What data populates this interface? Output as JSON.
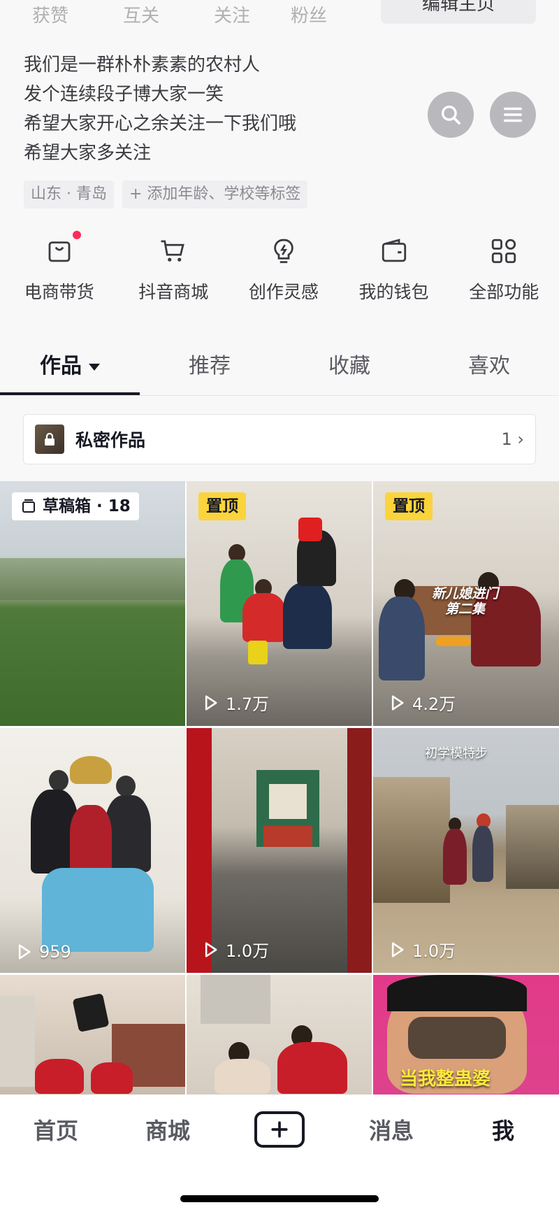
{
  "profile": {
    "stats": [
      "获赞",
      "互关",
      "关注",
      "粉丝"
    ],
    "edit_button": "编辑主页",
    "bio": [
      "我们是一群朴朴素素的农村人",
      "发个连续段子博大家一笑",
      "希望大家开心之余关注一下我们哦",
      "希望大家多关注"
    ],
    "tags": [
      "山东 · 青岛",
      "+ 添加年龄、学校等标签"
    ],
    "search_icon": "search-icon",
    "menu_icon": "menu-icon"
  },
  "functions": [
    {
      "label": "电商带货",
      "icon": "shopping-bag-icon"
    },
    {
      "label": "抖音商城",
      "icon": "cart-icon"
    },
    {
      "label": "创作灵感",
      "icon": "lightbulb-icon"
    },
    {
      "label": "我的钱包",
      "icon": "wallet-icon"
    },
    {
      "label": "全部功能",
      "icon": "grid-icon"
    }
  ],
  "tabs": [
    "作品",
    "推荐",
    "收藏",
    "喜欢"
  ],
  "private_works": {
    "label": "私密作品",
    "count": "1",
    "icon": "lock-icon"
  },
  "videos": [
    {
      "badge": "草稿箱 · 18",
      "plays": ""
    },
    {
      "badge": "置顶",
      "plays": "1.7万"
    },
    {
      "badge": "置顶",
      "plays": "4.2万",
      "caption": "新儿媳进门\n第二集"
    },
    {
      "badge": "",
      "plays": "959"
    },
    {
      "badge": "",
      "plays": "1.0万"
    },
    {
      "badge": "",
      "plays": "1.0万",
      "caption": "初学模特步"
    },
    {
      "badge": "",
      "plays": ""
    },
    {
      "badge": "",
      "plays": ""
    },
    {
      "badge": "",
      "plays": "",
      "caption": "当我整蛊婆"
    }
  ],
  "bottom_nav": [
    "首页",
    "商城",
    "+",
    "消息",
    "我"
  ],
  "colors": {
    "accent": "#fe2c55",
    "pin": "#fbd43c",
    "text": "#161823"
  }
}
